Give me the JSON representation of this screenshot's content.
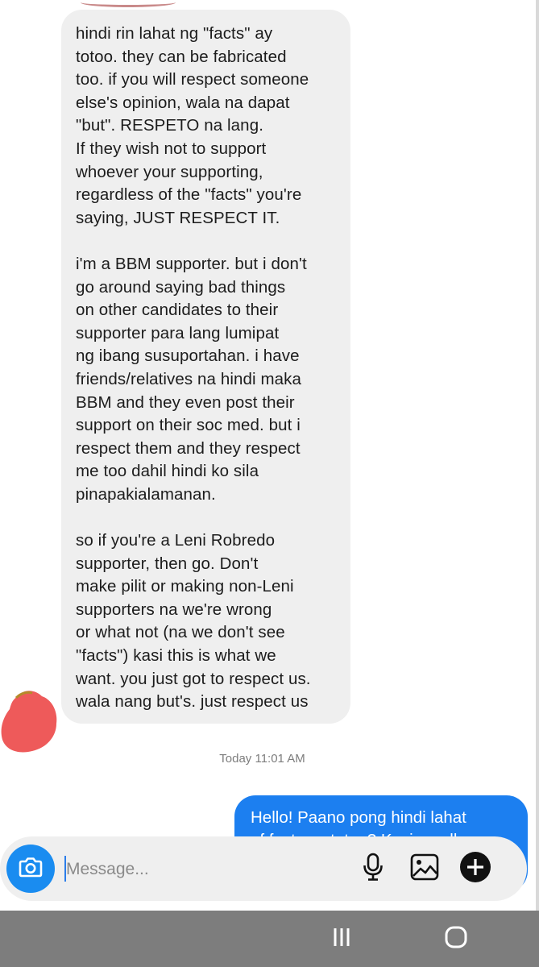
{
  "conversation": {
    "incoming_message": "hindi rin lahat ng \"facts\" ay\ntotoo. they can be fabricated\ntoo. if you will respect someone\nelse's opinion, wala na dapat\n\"but\". RESPETO na lang.\nIf they wish not to support\nwhoever your supporting,\nregardless of the \"facts\" you're\nsaying, JUST RESPECT IT.\n\ni'm a BBM supporter. but i don't\ngo around saying bad things\non other candidates to their\nsupporter para lang lumipat\nng ibang susuportahan. i have\nfriends/relatives na hindi maka\nBBM and they even post their\nsupport on their soc med. but i\nrespect them and they respect\nme too dahil hindi ko sila\npinapakialamanan.\n\nso if you're a Leni Robredo\nsupporter, then go. Don't\nmake pilit or making non-Leni\nsupporters na we're wrong\nor what not (na we don't see\n\"facts\") kasi this is what we\nwant. you just got to respect us.\nwala nang but's. just respect us",
    "timestamp": "Today 11:01 AM",
    "outgoing_message": "Hello! Paano pong hindi lahat\nof facts ay totoo? Kasi po ell"
  },
  "composer": {
    "placeholder": "Message...",
    "value": ""
  },
  "icons": {
    "camera": "camera-icon",
    "microphone": "microphone-icon",
    "gallery": "image-gallery-icon",
    "add": "plus-circle-icon",
    "recents": "recent-apps-icon",
    "home": "home-icon"
  },
  "colors": {
    "accent": "#1a8cf0",
    "outgoing_bubble": "#1c7ff0",
    "incoming_bubble": "#efefef",
    "avatar_redaction": "#ee5a5a",
    "nav_bar": "#7d7d7d"
  }
}
